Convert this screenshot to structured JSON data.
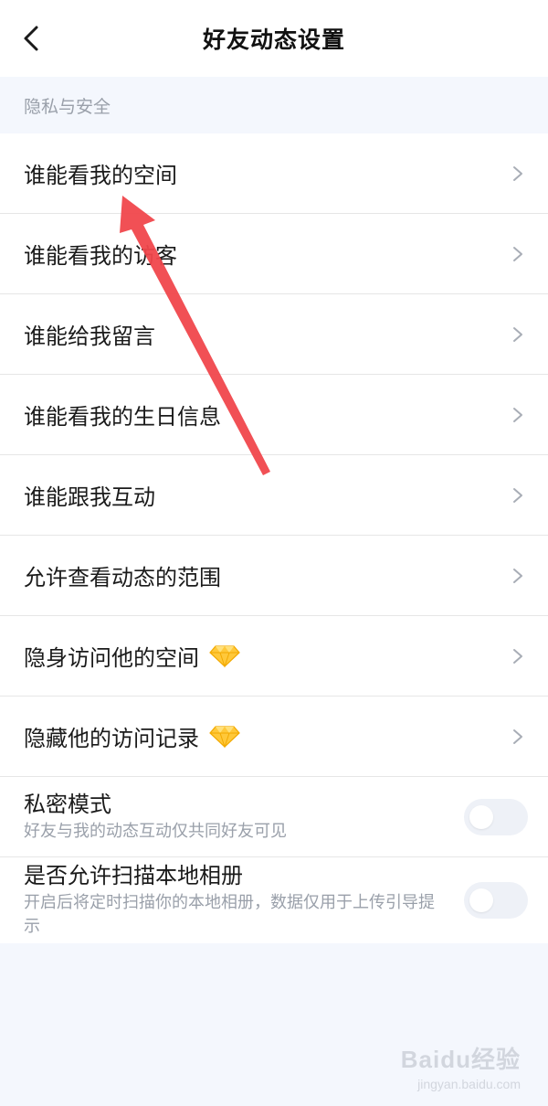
{
  "header": {
    "title": "好友动态设置",
    "back_icon": "chevron-left-icon"
  },
  "section": {
    "title": "隐私与安全"
  },
  "menu_items": [
    {
      "label": "谁能看我的空间"
    },
    {
      "label": "谁能看我的访客"
    },
    {
      "label": "谁能给我留言"
    },
    {
      "label": "谁能看我的生日信息"
    },
    {
      "label": "谁能跟我互动"
    },
    {
      "label": "允许查看动态的范围"
    },
    {
      "label": "隐身访问他的空间",
      "badge": "diamond-icon"
    },
    {
      "label": "隐藏他的访问记录",
      "badge": "diamond-icon"
    }
  ],
  "toggles": [
    {
      "title": "私密模式",
      "subtitle": "好友与我的动态互动仅共同好友可见",
      "enabled": false
    },
    {
      "title": "是否允许扫描本地相册",
      "subtitle": "开启后将定时扫描你的本地相册，数据仅用于上传引导提示",
      "enabled": false
    }
  ],
  "colors": {
    "background": "#f4f7fd",
    "row_background": "#ffffff",
    "annotation_arrow": "#f0474c",
    "diamond": "#ffc83a"
  },
  "watermark": {
    "brand": "Baidu经验",
    "url": "jingyan.baidu.com"
  }
}
